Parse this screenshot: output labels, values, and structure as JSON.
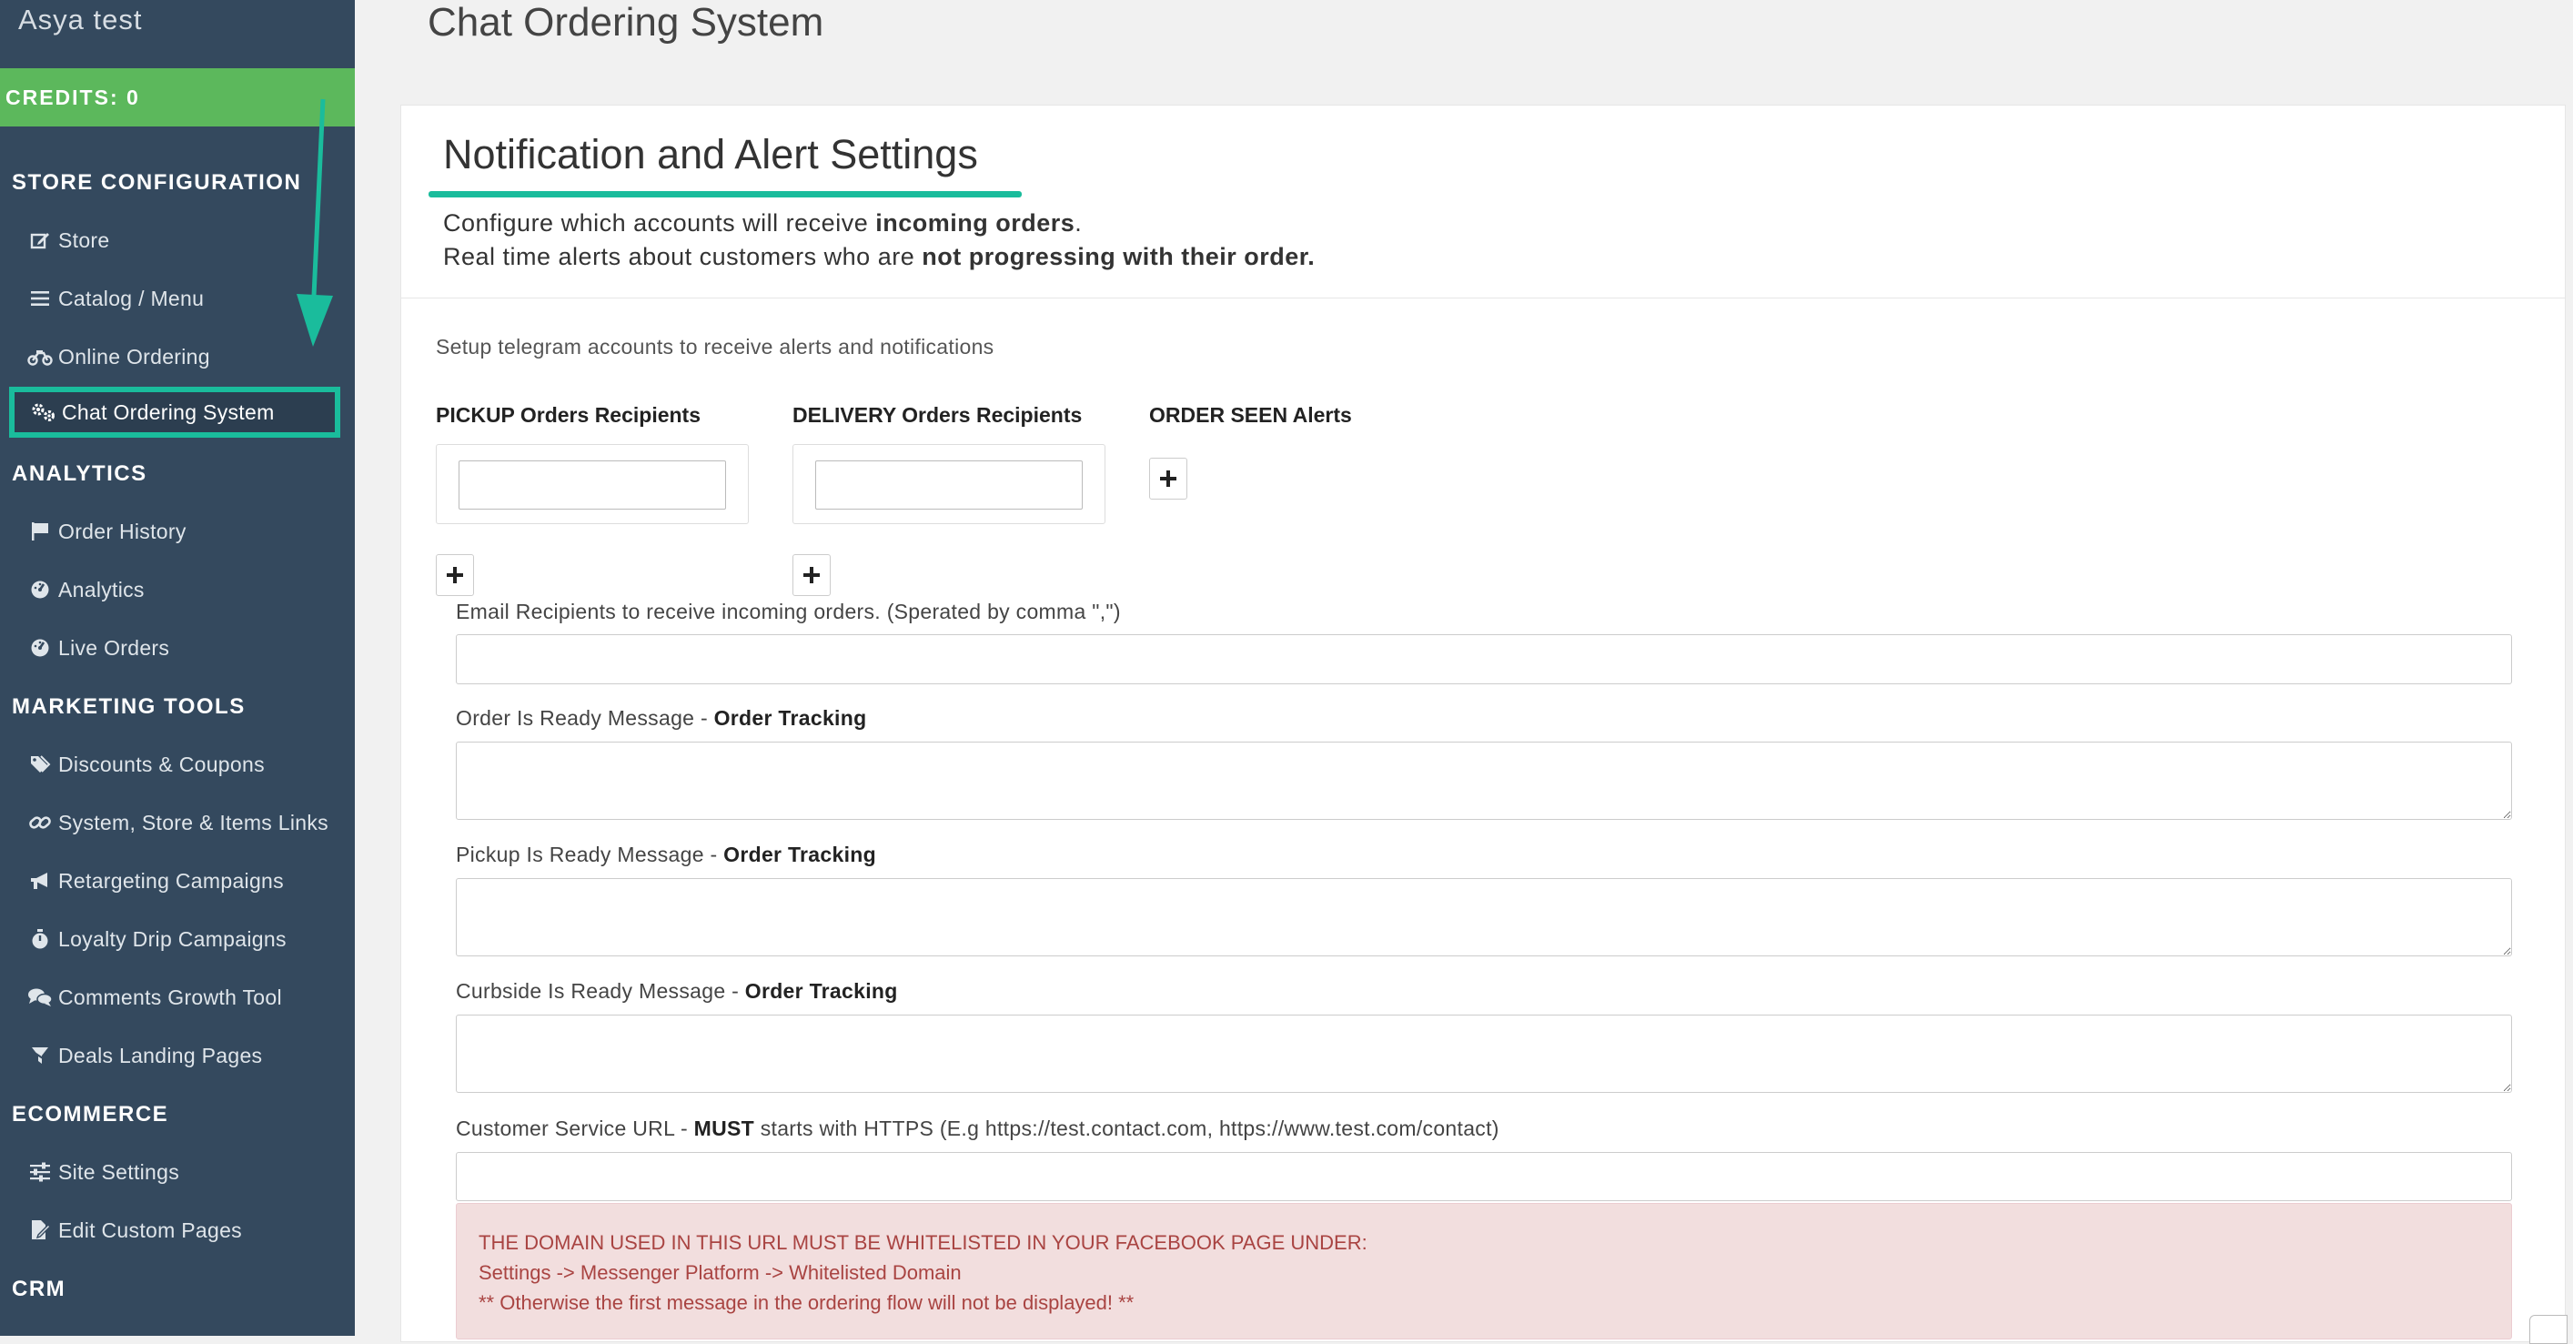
{
  "account": {
    "name": "Asya test"
  },
  "credits": {
    "label": "CREDITS:",
    "value": "0"
  },
  "page": {
    "title": "Chat Ordering System"
  },
  "colors": {
    "sidebar": "#34495e",
    "credits": "#5cb85c",
    "accent": "#1abc9c",
    "alert_bg": "#f2dede",
    "alert_text": "#a94442"
  },
  "sidebar": {
    "sections": [
      {
        "title": "STORE CONFIGURATION",
        "items": [
          {
            "label": "Store",
            "icon": "edit-icon"
          },
          {
            "label": "Catalog / Menu",
            "icon": "list-icon"
          },
          {
            "label": "Online Ordering",
            "icon": "motorcycle-icon"
          },
          {
            "label": "Chat Ordering System",
            "icon": "cogs-icon",
            "active": true
          }
        ]
      },
      {
        "title": "ANALYTICS",
        "items": [
          {
            "label": "Order History",
            "icon": "flag-icon"
          },
          {
            "label": "Analytics",
            "icon": "dashboard-icon"
          },
          {
            "label": "Live Orders",
            "icon": "dashboard-icon"
          }
        ]
      },
      {
        "title": "MARKETING TOOLS",
        "items": [
          {
            "label": "Discounts & Coupons",
            "icon": "tags-icon"
          },
          {
            "label": "System, Store & Items Links",
            "icon": "link-icon"
          },
          {
            "label": "Retargeting Campaigns",
            "icon": "bullhorn-icon"
          },
          {
            "label": "Loyalty Drip Campaigns",
            "icon": "stopwatch-icon"
          },
          {
            "label": "Comments Growth Tool",
            "icon": "comments-icon"
          },
          {
            "label": "Deals Landing Pages",
            "icon": "filter-icon"
          }
        ]
      },
      {
        "title": "ECOMMERCE",
        "items": [
          {
            "label": "Site Settings",
            "icon": "sliders-icon"
          },
          {
            "label": "Edit Custom Pages",
            "icon": "file-edit-icon"
          }
        ]
      },
      {
        "title": "CRM",
        "items": []
      }
    ]
  },
  "panel": {
    "title": "Notification and Alert Settings",
    "desc1_pre": "Configure which accounts will receive ",
    "desc1_bold": "incoming orders",
    "desc1_post": ".",
    "desc2_pre": "Real time alerts about customers who are ",
    "desc2_bold": "not progressing with their order.",
    "setup_text": "Setup telegram accounts to receive alerts and notifications",
    "pickup_label": "PICKUP Orders Recipients",
    "delivery_label": "DELIVERY Orders Recipients",
    "seen_label": "ORDER SEEN Alerts",
    "pickup_value": "",
    "delivery_value": "",
    "email_label": "Email Recipients to receive incoming orders. (Sperated by comma \",\")",
    "email_value": "",
    "order_ready_label": "Order Is Ready Message - ",
    "order_ready_bold": "Order Tracking",
    "pickup_ready_label": "Pickup Is Ready Message - ",
    "pickup_ready_bold": "Order Tracking",
    "curbside_ready_label": "Curbside Is Ready Message - ",
    "curbside_ready_bold": "Order Tracking",
    "csurl_label_pre": "Customer Service URL - ",
    "csurl_label_bold": "MUST",
    "csurl_label_post": " starts with HTTPS (E.g https://test.contact.com, https://www.test.com/contact)",
    "csurl_value": "",
    "alert_line1": "THE DOMAIN USED IN THIS URL MUST BE WHITELISTED IN YOUR FACEBOOK PAGE UNDER:",
    "alert_line2": "Settings -> Messenger Platform -> Whitelisted Domain",
    "alert_line3": "** Otherwise the first message in the ordering flow will not be displayed! **"
  }
}
